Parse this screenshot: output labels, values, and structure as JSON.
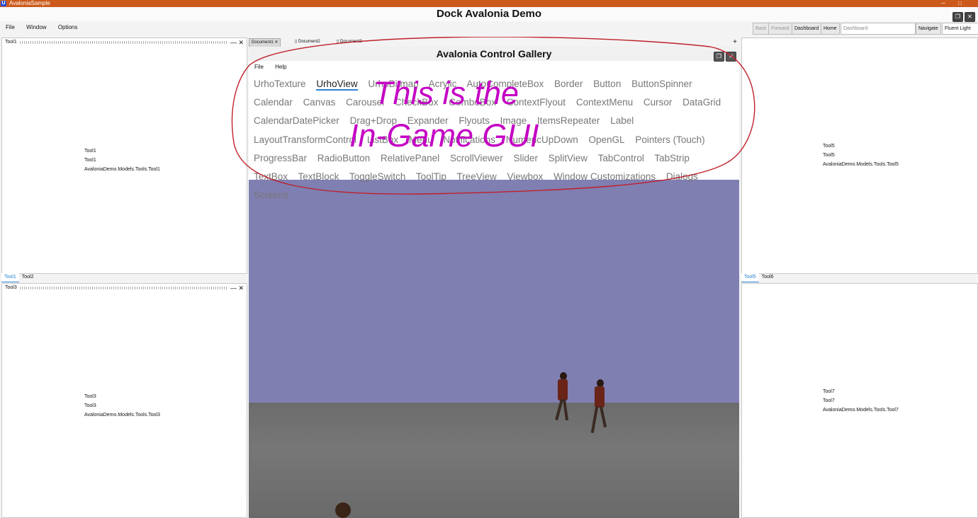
{
  "os": {
    "title": "AvaloniaSample",
    "icon": "U",
    "min": "─",
    "max": "□"
  },
  "window": {
    "title": "Dock Avalonia Demo",
    "restore_label": "❐",
    "close_label": "✕"
  },
  "menu": [
    "File",
    "Window",
    "Options"
  ],
  "nav": {
    "back": "Back",
    "forward": "Forward",
    "dashboard": "Dashboard",
    "home": "Home",
    "url_placeholder": "Dashboard",
    "navigate": "Navigate",
    "theme": "Fluent Light"
  },
  "tool1": {
    "title": "Tool1",
    "lines": [
      "Tool1",
      "Tool1",
      "AvaloniaDemo.Models.Tools.Tool1"
    ]
  },
  "tool3": {
    "title": "Tool3",
    "lines": [
      "Tool3",
      "Tool3",
      "AvaloniaDemo.Models.Tools.Tool3"
    ]
  },
  "tool5": {
    "lines": [
      "Tool5",
      "Tool5",
      "AvaloniaDemo.Models.Tools.Tool5"
    ]
  },
  "tool7": {
    "lines": [
      "Tool7",
      "Tool7",
      "AvaloniaDemo.Models.Tools.Tool7"
    ]
  },
  "left_tabs": [
    "Tool1",
    "Tool2"
  ],
  "right_tabs": [
    "Tool5",
    "Tool6"
  ],
  "panel_buttons": {
    "minimize": "—",
    "close": "✕"
  },
  "documents": {
    "tabs": [
      "Document1",
      "Document2",
      "Document3"
    ],
    "close": "✕",
    "add": "+"
  },
  "gallery": {
    "title": "Avalonia Control Gallery",
    "menu": [
      "File",
      "Help"
    ],
    "tabs": [
      "UrhoTexture",
      "UrhoView",
      "UrhoBitmap",
      "Acrylic",
      "AutoCompleteBox",
      "Border",
      "Button",
      "ButtonSpinner",
      "Calendar",
      "Canvas",
      "Carousel",
      "CheckBox",
      "ComboBox",
      "ContextFlyout",
      "ContextMenu",
      "Cursor",
      "DataGrid",
      "CalendarDatePicker",
      "Drag+Drop",
      "Expander",
      "Flyouts",
      "Image",
      "ItemsRepeater",
      "Label",
      "LayoutTransformControl",
      "ListBox",
      "Menu",
      "Notifications",
      "NumericUpDown",
      "OpenGL",
      "Pointers (Touch)",
      "ProgressBar",
      "RadioButton",
      "RelativePanel",
      "ScrollViewer",
      "Slider",
      "SplitView",
      "TabControl",
      "TabStrip",
      "TextBox",
      "TextBlock",
      "ToggleSwitch",
      "ToolTip",
      "TreeView",
      "Viewbox",
      "Window Customizations",
      "Dialogs",
      "Screens"
    ],
    "selected_tab": "UrhoView"
  },
  "annotation": {
    "line1": "This is the",
    "line2": "In-Game GUI",
    "color": "#c400c4",
    "ellipse_color": "#c0202a"
  }
}
